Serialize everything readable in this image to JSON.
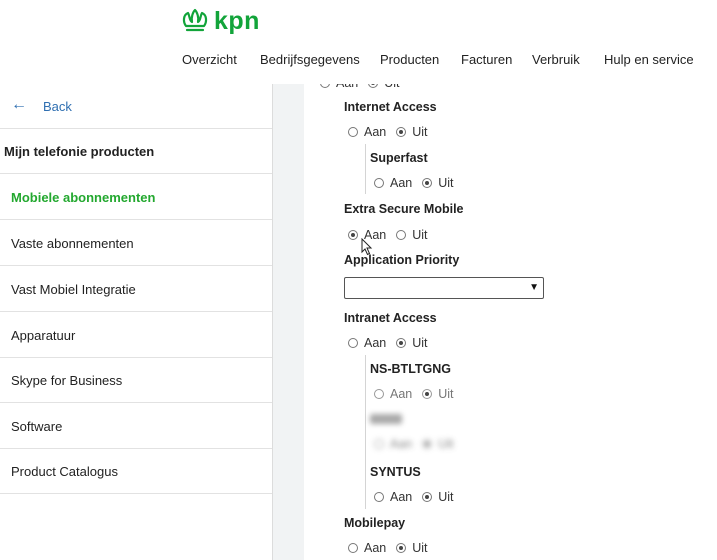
{
  "brand": {
    "name": "kpn",
    "color": "#12a43a",
    "icon": "kpn-crown-logo"
  },
  "nav": [
    {
      "label": "Overzicht"
    },
    {
      "label": "Bedrijfsgegevens"
    },
    {
      "label": "Producten"
    },
    {
      "label": "Facturen"
    },
    {
      "label": "Verbruik"
    },
    {
      "label": "Hulp en service"
    }
  ],
  "sidebar": {
    "back": {
      "label": "Back",
      "icon": "arrow-left-icon"
    },
    "title": "Mijn telefonie producten",
    "items": [
      {
        "label": "Mobiele abonnementen",
        "active": true
      },
      {
        "label": "Vaste abonnementen"
      },
      {
        "label": "Vast Mobiel Integratie"
      },
      {
        "label": "Apparatuur"
      },
      {
        "label": "Skype for Business"
      },
      {
        "label": "Software"
      },
      {
        "label": "Product Catalogus"
      }
    ]
  },
  "form": {
    "radio_on": "Aan",
    "radio_off": "Uit",
    "internet_access": {
      "label": "Internet Access",
      "value": "Uit"
    },
    "superfast": {
      "label": "Superfast",
      "value": "Uit"
    },
    "extra_secure": {
      "label": "Extra Secure Mobile",
      "value": "Aan"
    },
    "app_priority": {
      "label": "Application Priority",
      "value": ""
    },
    "intranet_access": {
      "label": "Intranet Access",
      "value": "Uit"
    },
    "ns": {
      "label": "NS-BTLTGNG",
      "value": "Uit"
    },
    "syntus": {
      "label": "SYNTUS",
      "value": "Uit"
    },
    "mobilepay": {
      "label": "Mobilepay",
      "value": "Uit"
    }
  }
}
